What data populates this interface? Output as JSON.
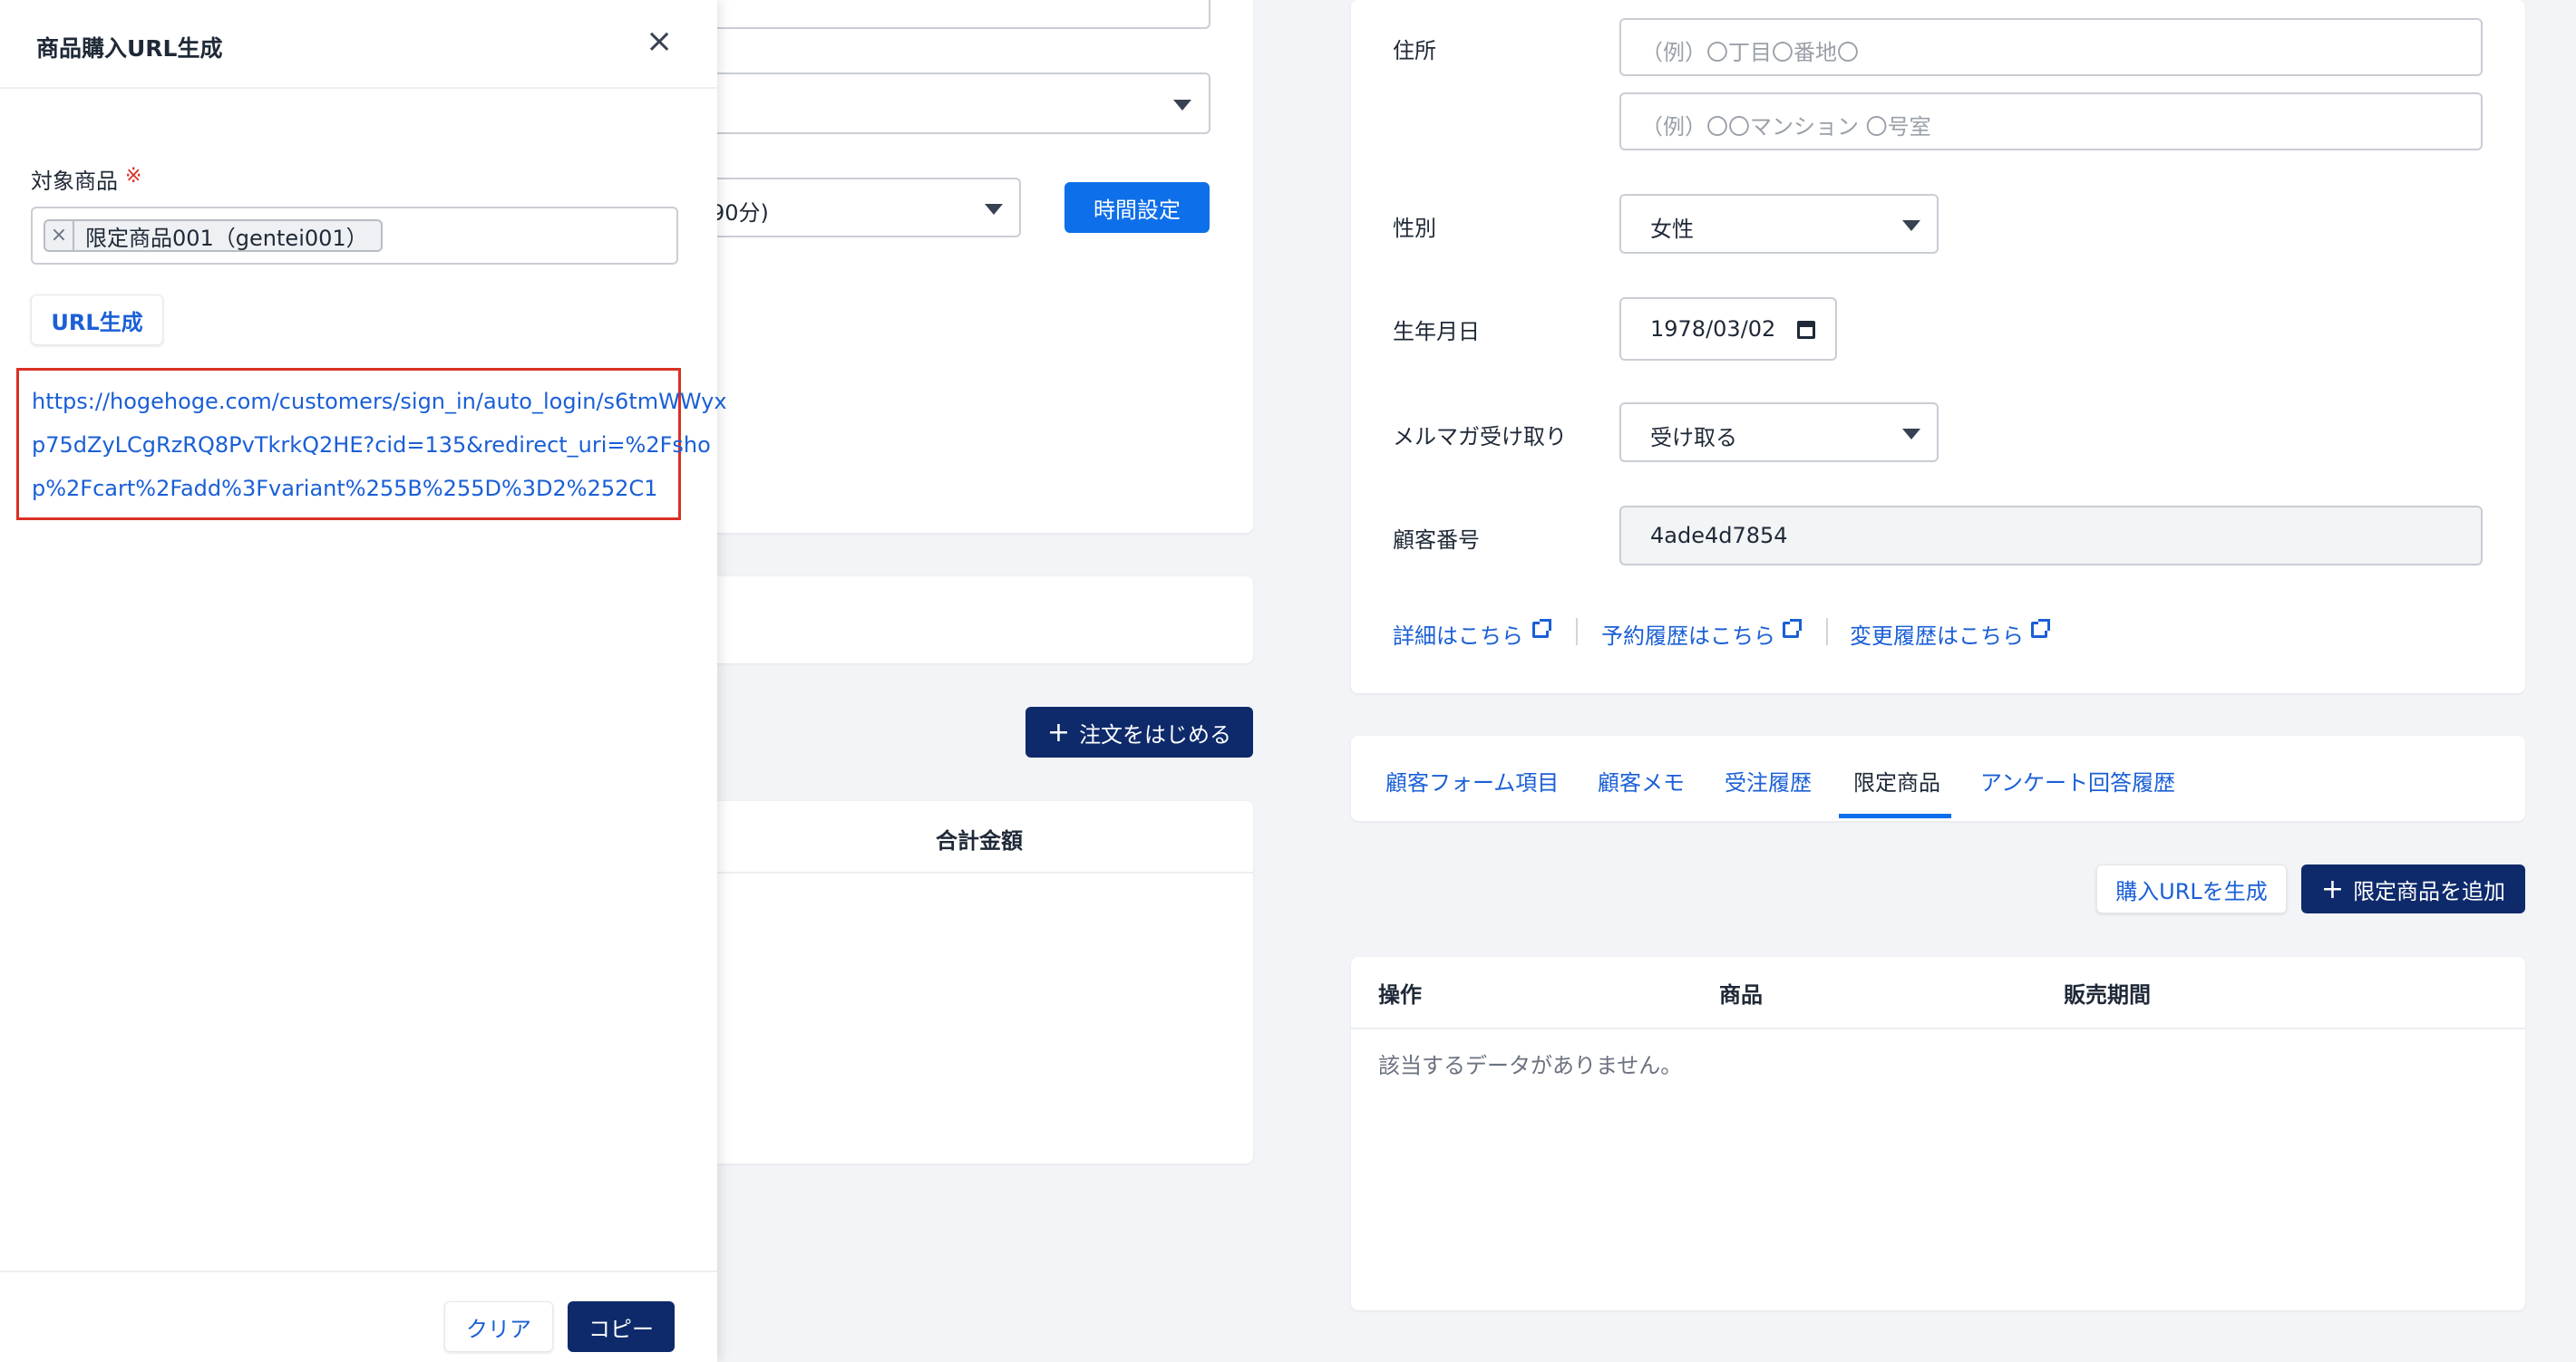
{
  "background_form": {
    "time_select_value": "90分)",
    "time_button": "時間設定",
    "order_button": "注文をはじめる",
    "table_header_total": "合計金額"
  },
  "customer": {
    "address_label": "住所",
    "address1_placeholder": "（例）〇丁目〇番地〇",
    "address2_placeholder": "（例）〇〇マンション 〇号室",
    "gender_label": "性別",
    "gender_value": "女性",
    "birthday_label": "生年月日",
    "birthday_value": "1978/03/02",
    "newsletter_label": "メルマガ受け取り",
    "newsletter_value": "受け取る",
    "customer_no_label": "顧客番号",
    "customer_no_value": "4ade4d7854",
    "links": [
      "詳細はこちら",
      "予約履歴はこちら",
      "変更履歴はこちら"
    ]
  },
  "tabs": {
    "items": [
      "顧客フォーム項目",
      "顧客メモ",
      "受注履歴",
      "限定商品",
      "アンケート回答履歴"
    ],
    "active_index": 3
  },
  "limited": {
    "generate_url_button": "購入URLを生成",
    "add_button": "限定商品を追加",
    "columns": [
      "操作",
      "商品",
      "販売期間"
    ],
    "empty_message": "該当するデータがありません。"
  },
  "drawer": {
    "title": "商品購入URL生成",
    "product_label": "対象商品",
    "required_mark": "※",
    "selected_tag": "限定商品001（gentei001）",
    "generate_button": "URL生成",
    "url_lines": [
      "https://hogehoge.com/customers/sign_in/auto_login/s6tmWWyx",
      "p75dZyLCgRzRQ8PvTkrkQ2HE?cid=135&redirect_uri=%2Fsho",
      "p%2Fcart%2Fadd%3Fvariant%255B%255D%3D2%252C1"
    ],
    "clear_button": "クリア",
    "copy_button": "コピー"
  },
  "colors": {
    "primary": "#0e6fea",
    "dark_navy": "#0e2a6b",
    "link": "#1a5fd6",
    "highlight_border": "#d93025",
    "required": "#d93025"
  }
}
